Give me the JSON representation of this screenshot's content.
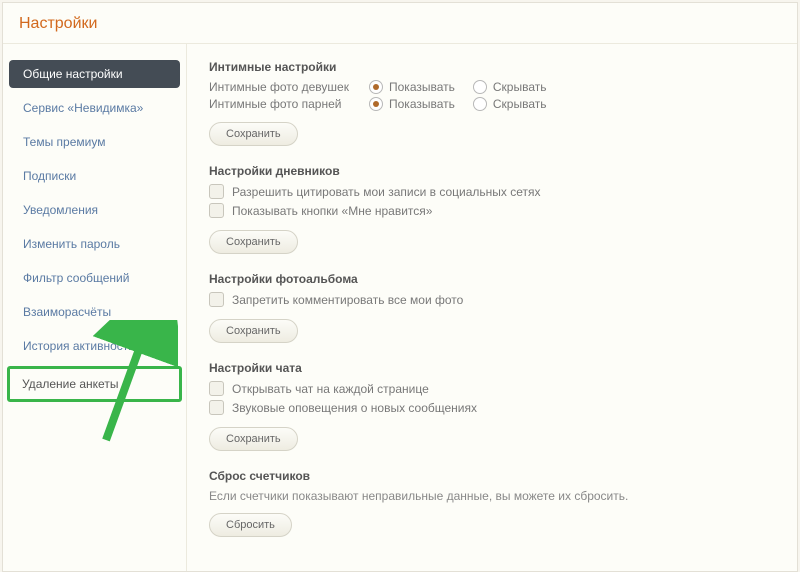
{
  "header": {
    "title": "Настройки"
  },
  "sidebar": {
    "items": [
      {
        "label": "Общие настройки",
        "active": true
      },
      {
        "label": "Сервис «Невидимка»"
      },
      {
        "label": "Темы премиум"
      },
      {
        "label": "Подписки"
      },
      {
        "label": "Уведомления"
      },
      {
        "label": "Изменить пароль"
      },
      {
        "label": "Фильтр сообщений"
      },
      {
        "label": "Взаиморасчёты"
      },
      {
        "label": "История активности"
      },
      {
        "label": "Удаление анкеты",
        "highlight": true
      }
    ]
  },
  "intimate": {
    "title": "Интимные настройки",
    "row1_label": "Интимные фото девушек",
    "row2_label": "Интимные фото парней",
    "opt_show": "Показывать",
    "opt_hide": "Скрывать",
    "save": "Сохранить"
  },
  "diary": {
    "title": "Настройки дневников",
    "chk1": "Разрешить цитировать мои записи в социальных сетях",
    "chk2": "Показывать кнопки «Мне нравится»",
    "save": "Сохранить"
  },
  "album": {
    "title": "Настройки фотоальбома",
    "chk1": "Запретить комментировать все мои фото",
    "save": "Сохранить"
  },
  "chat": {
    "title": "Настройки чата",
    "chk1": "Открывать чат на каждой странице",
    "chk2": "Звуковые оповещения о новых сообщениях",
    "save": "Сохранить"
  },
  "counters": {
    "title": "Сброс счетчиков",
    "desc": "Если счетчики показывают неправильные данные, вы можете их сбросить.",
    "reset": "Сбросить"
  }
}
